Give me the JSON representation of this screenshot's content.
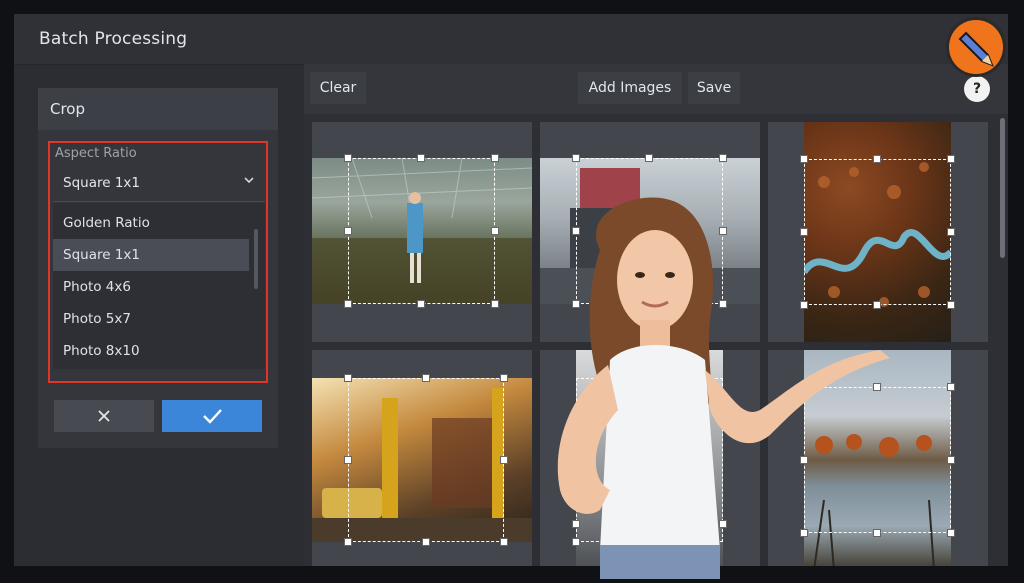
{
  "window": {
    "title": "Batch Processing"
  },
  "toolbar": {
    "clear_label": "Clear",
    "add_images_label": "Add Images",
    "save_label": "Save",
    "help_label": "?"
  },
  "crop_panel": {
    "heading": "Crop",
    "aspect_ratio_label": "Aspect Ratio",
    "selected_value": "Square 1x1",
    "options": [
      "Golden Ratio",
      "Square 1x1",
      "Photo 4x6",
      "Photo 5x7",
      "Photo 8x10"
    ],
    "selected_index": 1,
    "cancel_icon": "x-icon",
    "confirm_icon": "checkmark-icon"
  },
  "colors": {
    "accent": "#3b86d8",
    "highlight_border": "#e0362a",
    "panel": "#34363c",
    "background": "#2b2d33"
  },
  "images": [
    {
      "subject": "greenhouse"
    },
    {
      "subject": "city-street"
    },
    {
      "subject": "aerial-river"
    },
    {
      "subject": "street-traffic"
    },
    {
      "subject": "building"
    },
    {
      "subject": "lake-forest"
    }
  ]
}
